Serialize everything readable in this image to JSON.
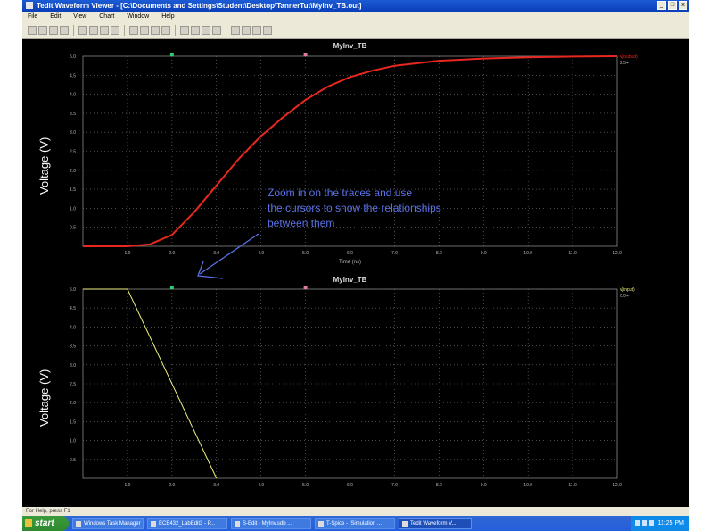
{
  "window": {
    "title": "Tedit Waveform Viewer - [C:\\Documents and Settings\\Student\\Desktop\\TannerTut\\MyInv_TB.out]"
  },
  "menu": [
    "File",
    "Edit",
    "View",
    "Chart",
    "Window",
    "Help"
  ],
  "toolbar_icons": [
    "new-icon",
    "open-icon",
    "save-icon",
    "print-icon",
    "cut-icon",
    "copy-icon",
    "paste-icon",
    "undo-icon",
    "zoom-in-icon",
    "zoom-out-icon",
    "zoom-fit-icon",
    "pan-icon",
    "cursor-icon",
    "measure-icon",
    "trace-icon",
    "grid-icon",
    "legend-icon",
    "export-icon",
    "settings-icon",
    "help-icon"
  ],
  "annotation": {
    "line1": "Zoom in on the traces and use",
    "line2": "the cursors to show the relationships",
    "line3": "between them"
  },
  "chart_data": [
    {
      "type": "line",
      "title": "MyInv_TB",
      "ylabel": "Voltage (V)",
      "xlabel": "Time (ns)",
      "xlim": [
        0,
        12
      ],
      "ylim": [
        0,
        5
      ],
      "x_ticks": [
        "1.0",
        "2.0",
        "3.0",
        "4.0",
        "5.0",
        "6.0",
        "7.0",
        "8.0",
        "9.0",
        "10.0",
        "11.0",
        "12.0"
      ],
      "y_ticks": [
        "0.5",
        "1.0",
        "1.5",
        "2.0",
        "2.5",
        "3.0",
        "3.5",
        "4.0",
        "4.5",
        "5.0"
      ],
      "series": [
        {
          "name": "v(output)",
          "color": "#e8281e",
          "x": [
            0.0,
            1.0,
            1.5,
            2.0,
            2.5,
            3.0,
            3.5,
            4.0,
            4.5,
            5.0,
            5.5,
            6.0,
            6.5,
            7.0,
            8.0,
            9.0,
            10.0,
            11.0,
            12.0
          ],
          "y": [
            0.0,
            0.0,
            0.05,
            0.3,
            0.9,
            1.6,
            2.3,
            2.9,
            3.4,
            3.85,
            4.2,
            4.45,
            4.62,
            4.75,
            4.88,
            4.94,
            4.97,
            4.99,
            5.0
          ]
        }
      ],
      "legend": [
        "v(output)",
        "2.5+"
      ]
    },
    {
      "type": "line",
      "title": "MyInv_TB",
      "ylabel": "Voltage (V)",
      "xlabel": "",
      "xlim": [
        0,
        12
      ],
      "ylim": [
        0,
        5
      ],
      "x_ticks": [
        "1.0",
        "2.0",
        "3.0",
        "4.0",
        "5.0",
        "6.0",
        "7.0",
        "8.0",
        "9.0",
        "10.0",
        "11.0",
        "12.0"
      ],
      "y_ticks": [
        "0.5",
        "1.0",
        "1.5",
        "2.0",
        "2.5",
        "3.0",
        "3.5",
        "4.0",
        "4.5",
        "5.0"
      ],
      "series": [
        {
          "name": "v(input)",
          "color": "#f0f080",
          "x": [
            0.0,
            1.0,
            3.0
          ],
          "y": [
            5.0,
            5.0,
            0.0
          ]
        }
      ],
      "legend": [
        "v(input)",
        "0.0+"
      ]
    }
  ],
  "statusbar": {
    "text": "For Help, press F1"
  },
  "taskbar": {
    "start": "start",
    "items": [
      "Windows Task Manager",
      "ECE432_LabEdit3 - P...",
      "S-Edit - MyInv.sdb ...",
      "T-Spice - [Simulation ...",
      "Tedit Waveform V..."
    ],
    "clock": "11:25 PM"
  }
}
